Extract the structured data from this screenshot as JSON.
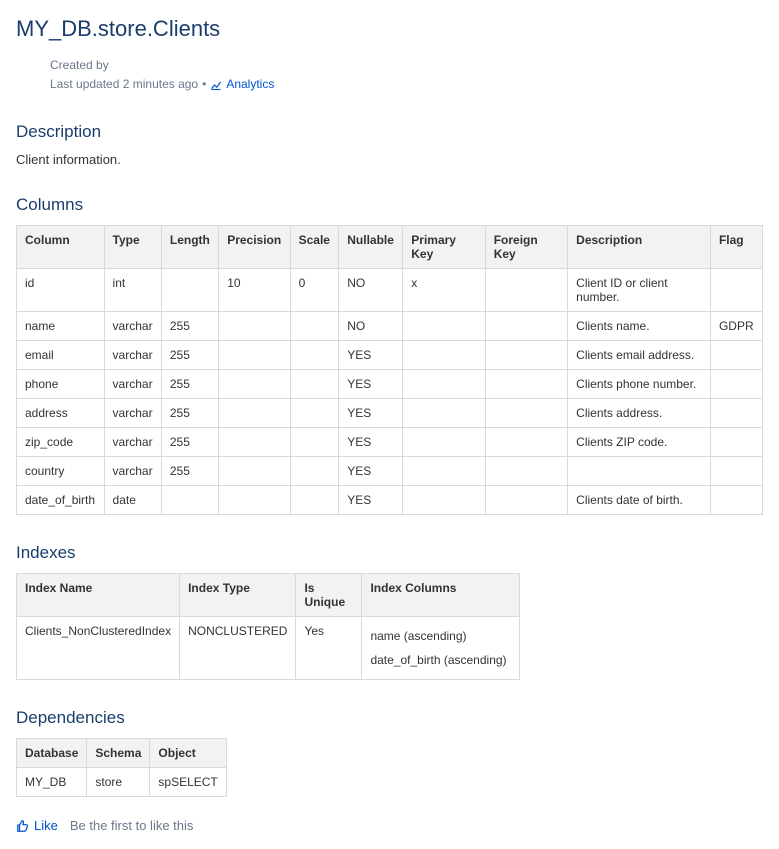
{
  "title": "MY_DB.store.Clients",
  "meta": {
    "created_by_label": "Created by",
    "last_updated": "Last updated 2 minutes ago",
    "separator": "•",
    "analytics_label": "Analytics"
  },
  "description": {
    "heading": "Description",
    "text": "Client information."
  },
  "columns_section": {
    "heading": "Columns",
    "headers": [
      "Column",
      "Type",
      "Length",
      "Precision",
      "Scale",
      "Nullable",
      "Primary Key",
      "Foreign Key",
      "Description",
      "Flag"
    ],
    "rows": [
      {
        "column": "id",
        "type": "int",
        "length": "",
        "precision": "10",
        "scale": "0",
        "nullable": "NO",
        "pk": "x",
        "fk": "",
        "desc": "Client ID or client number.",
        "flag": ""
      },
      {
        "column": "name",
        "type": "varchar",
        "length": "255",
        "precision": "",
        "scale": "",
        "nullable": "NO",
        "pk": "",
        "fk": "",
        "desc": "Clients name.",
        "flag": "GDPR"
      },
      {
        "column": "email",
        "type": "varchar",
        "length": "255",
        "precision": "",
        "scale": "",
        "nullable": "YES",
        "pk": "",
        "fk": "",
        "desc": "Clients email address.",
        "flag": ""
      },
      {
        "column": "phone",
        "type": "varchar",
        "length": "255",
        "precision": "",
        "scale": "",
        "nullable": "YES",
        "pk": "",
        "fk": "",
        "desc": "Clients phone number.",
        "flag": ""
      },
      {
        "column": "address",
        "type": "varchar",
        "length": "255",
        "precision": "",
        "scale": "",
        "nullable": "YES",
        "pk": "",
        "fk": "",
        "desc": "Clients address.",
        "flag": ""
      },
      {
        "column": "zip_code",
        "type": "varchar",
        "length": "255",
        "precision": "",
        "scale": "",
        "nullable": "YES",
        "pk": "",
        "fk": "",
        "desc": "Clients ZIP code.",
        "flag": ""
      },
      {
        "column": "country",
        "type": "varchar",
        "length": "255",
        "precision": "",
        "scale": "",
        "nullable": "YES",
        "pk": "",
        "fk": "",
        "desc": "",
        "flag": ""
      },
      {
        "column": "date_of_birth",
        "type": "date",
        "length": "",
        "precision": "",
        "scale": "",
        "nullable": "YES",
        "pk": "",
        "fk": "",
        "desc": "Clients date of birth.",
        "flag": ""
      }
    ]
  },
  "indexes_section": {
    "heading": "Indexes",
    "headers": [
      "Index Name",
      "Index Type",
      "Is Unique",
      "Index Columns"
    ],
    "rows": [
      {
        "name": "Clients_NonClusteredIndex",
        "type": "NONCLUSTERED",
        "unique": "Yes",
        "cols": [
          "name (ascending)",
          "date_of_birth (ascending)"
        ]
      }
    ]
  },
  "dependencies_section": {
    "heading": "Dependencies",
    "headers": [
      "Database",
      "Schema",
      "Object"
    ],
    "rows": [
      {
        "db": "MY_DB",
        "schema": "store",
        "object": "spSELECT"
      }
    ]
  },
  "like": {
    "like_label": "Like",
    "prompt": "Be the first to like this"
  }
}
